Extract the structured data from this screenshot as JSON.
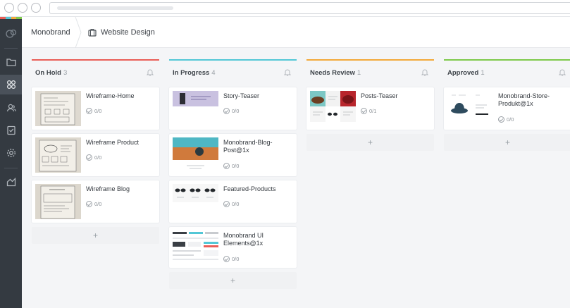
{
  "header": {
    "workspace": "Monobrand",
    "project": "Website Design"
  },
  "sidebar": {
    "items": [
      {
        "icon": "logo-icon"
      },
      {
        "icon": "folder-icon"
      },
      {
        "icon": "board-icon",
        "active": true
      },
      {
        "icon": "users-icon"
      },
      {
        "icon": "checklist-icon"
      },
      {
        "icon": "settings-icon"
      },
      {
        "icon": "reports-icon"
      }
    ]
  },
  "colors": {
    "on_hold": "#e95e57",
    "in_progress": "#53c7d6",
    "needs_review": "#f3a93a",
    "approved": "#7ec94a",
    "sidebar": "#343a41"
  },
  "columns": [
    {
      "title": "On Hold",
      "count": "3",
      "cards": [
        {
          "title": "Wireframe-Home",
          "meta": "0/0"
        },
        {
          "title": "Wireframe Product",
          "meta": "0/0"
        },
        {
          "title": "Wireframe Blog",
          "meta": "0/0"
        }
      ],
      "add_label": "+"
    },
    {
      "title": "In Progress",
      "count": "4",
      "cards": [
        {
          "title": "Story-Teaser",
          "meta": "0/0"
        },
        {
          "title": "Monobrand-Blog-Post@1x",
          "meta": "0/0"
        },
        {
          "title": "Featured-Products",
          "meta": "0/0"
        },
        {
          "title": "Monobrand UI Elements@1x",
          "meta": "0/0"
        }
      ],
      "add_label": "+"
    },
    {
      "title": "Needs Review",
      "count": "1",
      "cards": [
        {
          "title": "Posts-Teaser",
          "meta": "0/1"
        }
      ],
      "add_label": "+"
    },
    {
      "title": "Approved",
      "count": "1",
      "cards": [
        {
          "title": "Monobrand-Store-Produkt@1x",
          "meta": "0/0"
        }
      ],
      "add_label": "+"
    }
  ]
}
